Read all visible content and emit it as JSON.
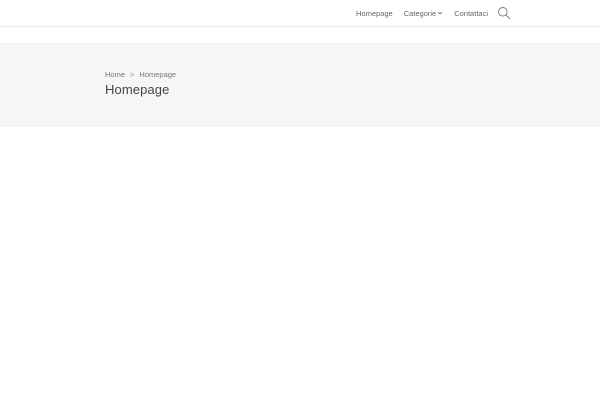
{
  "nav": {
    "items": [
      {
        "label": "Homepage"
      },
      {
        "label": "Categorie",
        "icon": "chevron-down-icon"
      },
      {
        "label": "Contattaci"
      }
    ],
    "search_icon": "search-icon"
  },
  "hero": {
    "breadcrumb": {
      "home": "Home",
      "separator": ">",
      "current": "Homepage"
    },
    "title": "Homepage"
  },
  "colors": {
    "hero_background": "#f6f6f6",
    "text": "#555555"
  }
}
